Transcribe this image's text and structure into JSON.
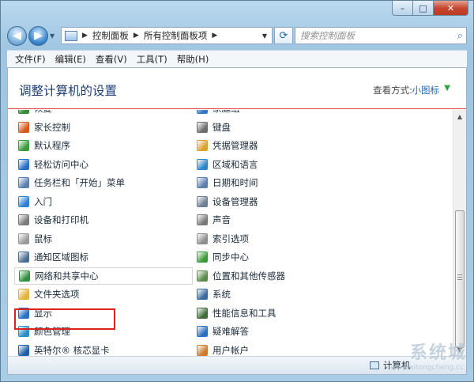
{
  "window": {
    "caption": {
      "minimize": "–",
      "maximize": "□",
      "close": "✕"
    }
  },
  "address": {
    "crumbs": [
      "控制面板",
      "所有控制面板项"
    ],
    "search_placeholder": "搜索控制面板"
  },
  "menu": [
    "文件(F)",
    "编辑(E)",
    "查看(V)",
    "工具(T)",
    "帮助(H)"
  ],
  "header": {
    "title": "调整计算机的设置",
    "view_by_label": "查看方式:",
    "view_by_value": "小图标"
  },
  "items_left": [
    {
      "label": "恢复",
      "icon": "restore-icon",
      "color": "#3a8a3a"
    },
    {
      "label": "家长控制",
      "icon": "parental-controls-icon",
      "color": "#d35a1d"
    },
    {
      "label": "默认程序",
      "icon": "default-programs-icon",
      "color": "#3b9a3b"
    },
    {
      "label": "轻松访问中心",
      "icon": "ease-of-access-icon",
      "color": "#2a6fc2"
    },
    {
      "label": "任务栏和「开始」菜单",
      "icon": "taskbar-icon",
      "color": "#5a7fae"
    },
    {
      "label": "入门",
      "icon": "getting-started-icon",
      "color": "#2f82d0"
    },
    {
      "label": "设备和打印机",
      "icon": "devices-printers-icon",
      "color": "#7a7a7a"
    },
    {
      "label": "鼠标",
      "icon": "mouse-icon",
      "color": "#9a9a9a"
    },
    {
      "label": "通知区域图标",
      "icon": "notification-area-icon",
      "color": "#4d6e92"
    },
    {
      "label": "网络和共享中心",
      "icon": "network-sharing-icon",
      "color": "#2f8f3f"
    },
    {
      "label": "文件夹选项",
      "icon": "folder-options-icon",
      "color": "#e0b43a"
    },
    {
      "label": "显示",
      "icon": "display-icon",
      "color": "#2a6fc2"
    },
    {
      "label": "颜色管理",
      "icon": "color-management-icon",
      "color": "#2a8ec2"
    },
    {
      "label": "英特尔® 核芯显卡",
      "icon": "intel-graphics-icon",
      "color": "#1f5fa8"
    }
  ],
  "items_right": [
    {
      "label": "家庭组",
      "icon": "homegroup-icon",
      "color": "#3a7ac2"
    },
    {
      "label": "键盘",
      "icon": "keyboard-icon",
      "color": "#6d6d6d"
    },
    {
      "label": "凭据管理器",
      "icon": "credential-manager-icon",
      "color": "#d8a22e"
    },
    {
      "label": "区域和语言",
      "icon": "region-language-icon",
      "color": "#2f86c9"
    },
    {
      "label": "日期和时间",
      "icon": "date-time-icon",
      "color": "#5a7fae"
    },
    {
      "label": "设备管理器",
      "icon": "device-manager-icon",
      "color": "#6d7f93"
    },
    {
      "label": "声音",
      "icon": "sound-icon",
      "color": "#7a7a7a"
    },
    {
      "label": "索引选项",
      "icon": "indexing-options-icon",
      "color": "#8d8d8d"
    },
    {
      "label": "同步中心",
      "icon": "sync-center-icon",
      "color": "#3b9a3b"
    },
    {
      "label": "位置和其他传感器",
      "icon": "location-sensors-icon",
      "color": "#5a8a4a"
    },
    {
      "label": "系统",
      "icon": "system-icon",
      "color": "#3a6aa0"
    },
    {
      "label": "性能信息和工具",
      "icon": "performance-icon",
      "color": "#3f6e3a"
    },
    {
      "label": "疑难解答",
      "icon": "troubleshooting-icon",
      "color": "#2a6fc2"
    },
    {
      "label": "用户帐户",
      "icon": "user-accounts-icon",
      "color": "#d07a2a"
    }
  ],
  "status": {
    "text": "计算机"
  },
  "watermark": {
    "text": "系统城",
    "sub": "www.xitongcheng.cc"
  }
}
